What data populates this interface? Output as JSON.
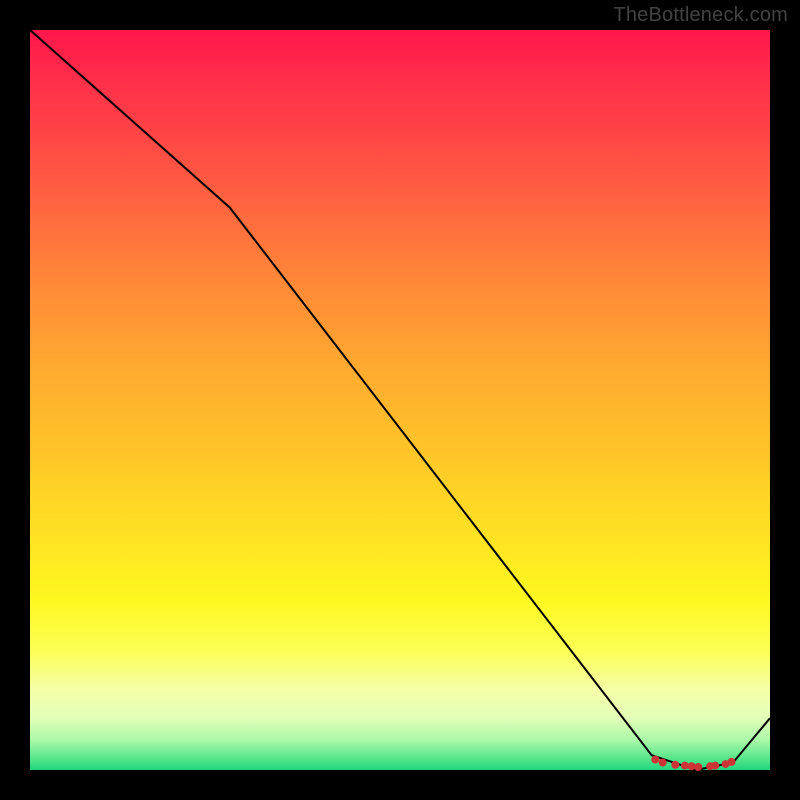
{
  "watermark": "TheBottleneck.com",
  "chart_data": {
    "type": "line",
    "title": "",
    "xlabel": "",
    "ylabel": "",
    "xlim": [
      0,
      100
    ],
    "ylim": [
      0,
      100
    ],
    "series": [
      {
        "name": "curve",
        "x": [
          0,
          27,
          84,
          90,
          95,
          100
        ],
        "values": [
          100,
          76,
          2,
          0,
          1,
          7
        ]
      }
    ],
    "markers": {
      "name": "bottom-cluster",
      "x": [
        84.5,
        85.5,
        87.2,
        88.5,
        89.4,
        90.3,
        91.9,
        92.6,
        94.0,
        94.8
      ],
      "values": [
        1.4,
        1.0,
        0.7,
        0.6,
        0.5,
        0.4,
        0.5,
        0.6,
        0.8,
        1.1
      ]
    },
    "gradient_stops": [
      {
        "pct": 0,
        "color": "#ff174b"
      },
      {
        "pct": 7,
        "color": "#ff2f4a"
      },
      {
        "pct": 20,
        "color": "#ff5842"
      },
      {
        "pct": 33,
        "color": "#ff8538"
      },
      {
        "pct": 45,
        "color": "#ffa830"
      },
      {
        "pct": 57,
        "color": "#ffc528"
      },
      {
        "pct": 69,
        "color": "#ffe423"
      },
      {
        "pct": 77,
        "color": "#fef81f"
      },
      {
        "pct": 84,
        "color": "#fcff57"
      },
      {
        "pct": 89,
        "color": "#f6ffa6"
      },
      {
        "pct": 93,
        "color": "#e2ffb8"
      },
      {
        "pct": 96,
        "color": "#a9f9a8"
      },
      {
        "pct": 98.5,
        "color": "#55e58a"
      },
      {
        "pct": 100,
        "color": "#20d680"
      }
    ]
  }
}
